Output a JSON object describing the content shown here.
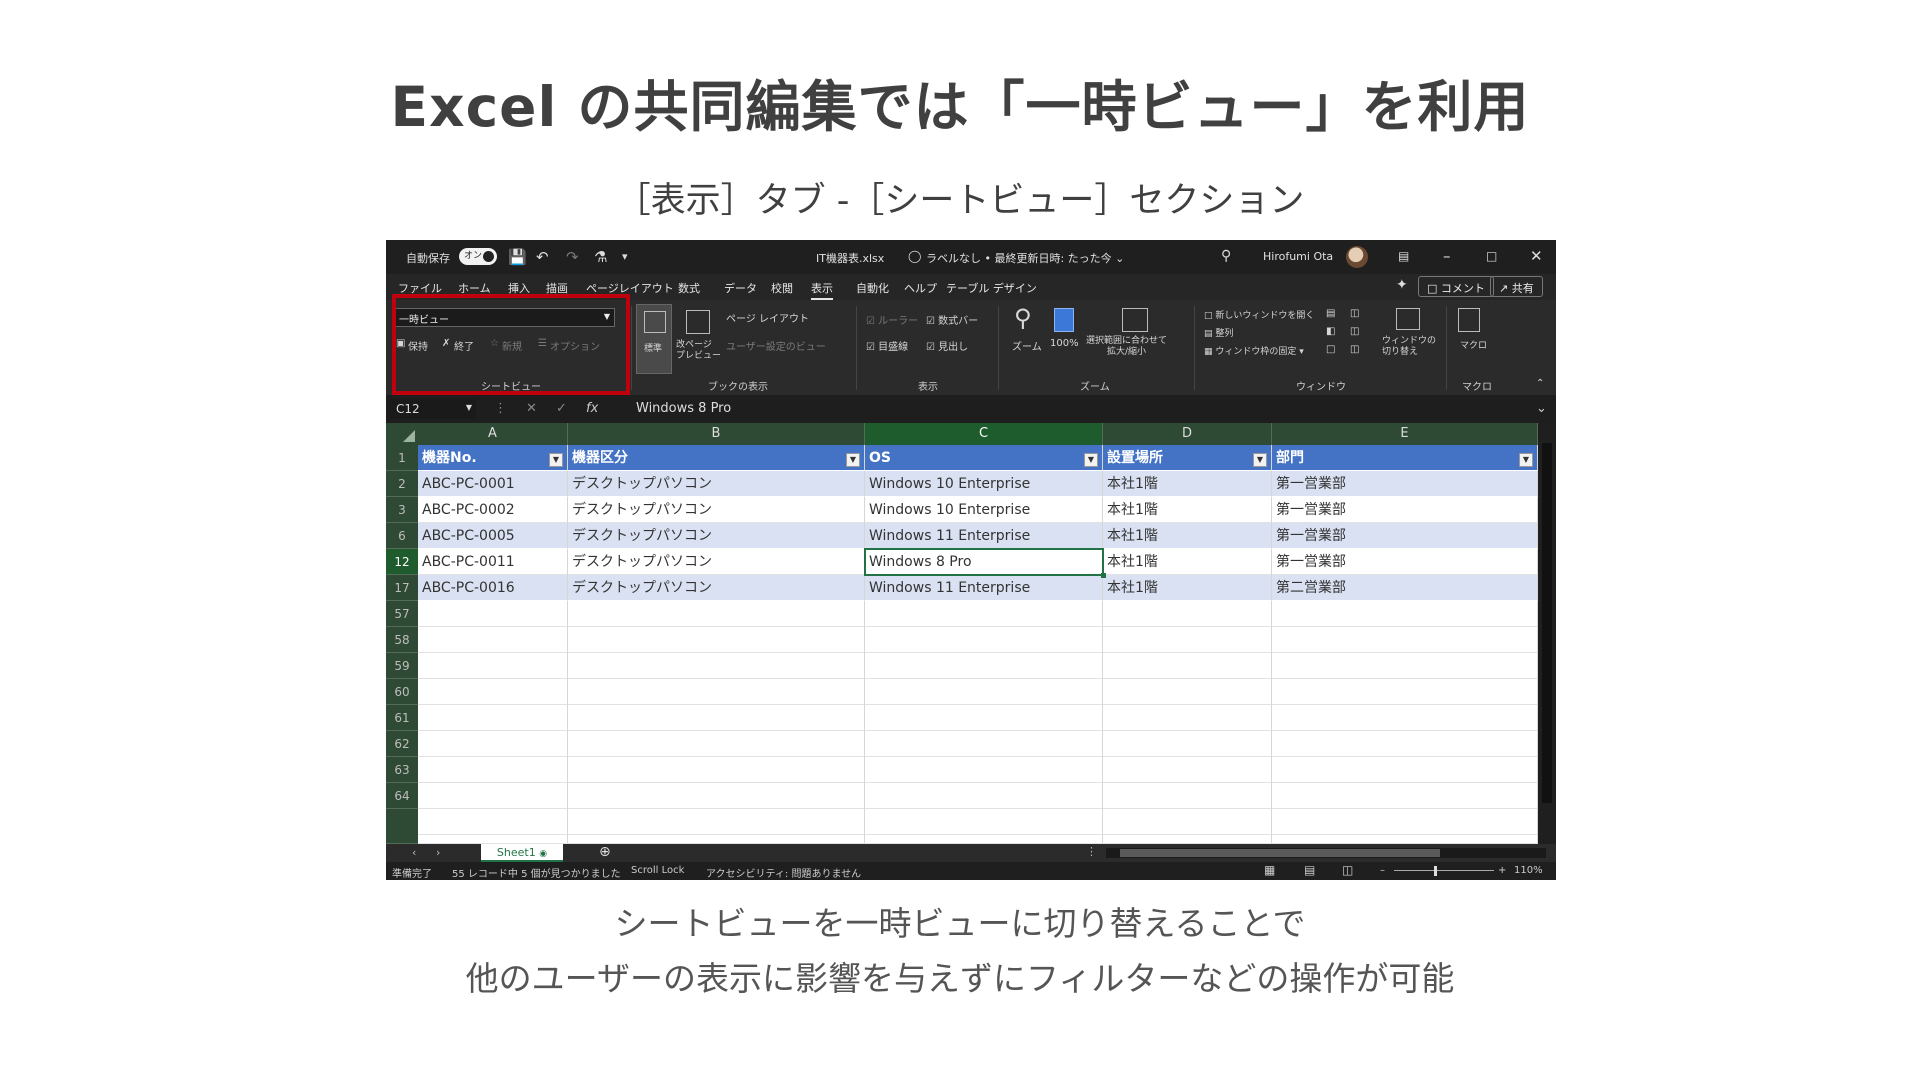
{
  "slide": {
    "title": "Excel の共同編集では「一時ビュー」を利用",
    "subtitle": "［表示］タブ -［シートビュー］セクション",
    "caption_line1": "シートビューを一時ビューに切り替えることで",
    "caption_line2": "他のユーザーの表示に影響を与えずにフィルターなどの操作が可能"
  },
  "titlebar": {
    "autosave": "自動保存",
    "autosave_state": "オン",
    "filename": "IT機器表.xlsx",
    "sensitivity": "ラベルなし • 最終更新日時: たった今 ⌄",
    "user": "Hirofumi Ota"
  },
  "menu": {
    "items": [
      "ファイル",
      "ホーム",
      "挿入",
      "描画",
      "ページレイアウト",
      "数式",
      "データ",
      "校閲",
      "表示",
      "自動化",
      "ヘルプ",
      "テーブル デザイン"
    ],
    "active_index": 8,
    "comment": "コメント",
    "share": "共有"
  },
  "ribbon": {
    "sheetview_dropdown": "一時ビュー",
    "sheetview_keep": "保持",
    "sheetview_exit": "終了",
    "sheetview_new": "新規",
    "sheetview_options": "オプション",
    "group_sheetview": "シートビュー",
    "normal": "標準",
    "page_break": "改ページ\nプレビュー",
    "page_layout": "ページ レイアウト",
    "custom_view": "ユーザー設定のビュー",
    "group_book_view": "ブックの表示",
    "ruler": "ルーラー",
    "formula_bar": "数式バー",
    "gridlines": "目盛線",
    "headings": "見出し",
    "group_show": "表示",
    "zoom": "ズーム",
    "zoom_100": "100%",
    "zoom_selection": "選択範囲に合わせて\n拡大/縮小",
    "group_zoom": "ズーム",
    "new_window": "新しいウィンドウを開く",
    "arrange": "整列",
    "freeze": "ウィンドウ枠の固定",
    "switch_window": "ウィンドウの\n切り替え",
    "group_window": "ウィンドウ",
    "macro": "マクロ",
    "group_macro": "マクロ"
  },
  "formula_bar": {
    "name_box": "C12",
    "value": "Windows 8 Pro"
  },
  "columns": [
    "A",
    "B",
    "C",
    "D",
    "E"
  ],
  "table": {
    "headers": [
      "機器No.",
      "機器区分",
      "OS",
      "設置場所",
      "部門"
    ],
    "rows": [
      {
        "row": "2",
        "cells": [
          "ABC-PC-0001",
          "デスクトップパソコン",
          "Windows 10 Enterprise",
          "本社1階",
          "第一営業部"
        ]
      },
      {
        "row": "3",
        "cells": [
          "ABC-PC-0002",
          "デスクトップパソコン",
          "Windows 10 Enterprise",
          "本社1階",
          "第一営業部"
        ]
      },
      {
        "row": "6",
        "cells": [
          "ABC-PC-0005",
          "デスクトップパソコン",
          "Windows 11 Enterprise",
          "本社1階",
          "第一営業部"
        ]
      },
      {
        "row": "12",
        "cells": [
          "ABC-PC-0011",
          "デスクトップパソコン",
          "Windows 8 Pro",
          "本社1階",
          "第一営業部"
        ]
      },
      {
        "row": "17",
        "cells": [
          "ABC-PC-0016",
          "デスクトップパソコン",
          "Windows 11 Enterprise",
          "本社1階",
          "第二営業部"
        ]
      }
    ],
    "header_row": "1",
    "empty_rows": [
      "57",
      "58",
      "59",
      "60",
      "61",
      "62",
      "63",
      "64"
    ]
  },
  "sheet": {
    "tab": "Sheet1"
  },
  "status": {
    "ready": "準備完了",
    "records": "55 レコード中 5 個が見つかりました",
    "scroll_lock": "Scroll Lock",
    "accessibility": "アクセシビリティ: 問題ありません",
    "zoom": "110%"
  }
}
